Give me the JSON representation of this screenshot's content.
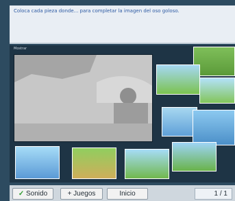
{
  "instructions": {
    "text": "Coloca cada pieza donde... para completar la imagen del oso goloso."
  },
  "board": {
    "mini_label": "Mostrar"
  },
  "footer": {
    "sound_label": "Sonido",
    "more_games_label": "+ Juegos",
    "start_label": "Inicio",
    "counter": "1 / 1"
  }
}
